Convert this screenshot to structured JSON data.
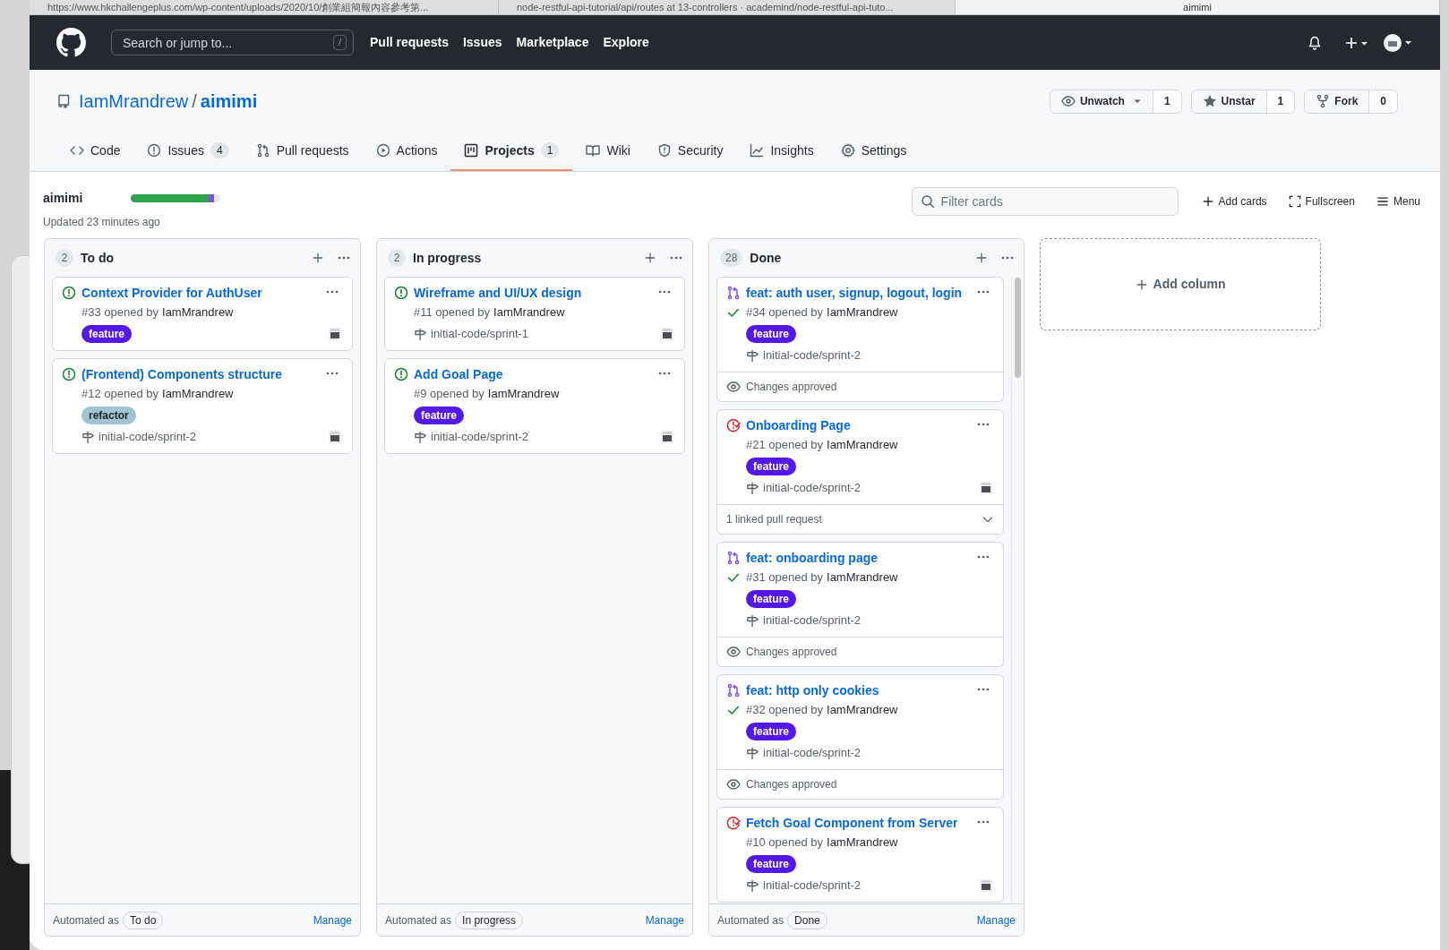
{
  "browser_tabs": [
    {
      "title": "https://www.hkchallengeplus.com/wp-content/uploads/2020/10/創業組簡報內容參考第...",
      "selected": false
    },
    {
      "title": "node-restful-api-tutorial/api/routes at 13-controllers · academind/node-restful-api-tuto...",
      "selected": false
    },
    {
      "title": "aimimi",
      "selected": true
    }
  ],
  "header": {
    "search_placeholder": "Search or jump to...",
    "search_key": "/",
    "nav": [
      "Pull requests",
      "Issues",
      "Marketplace",
      "Explore"
    ]
  },
  "repo": {
    "owner": "IamMrandrew",
    "separator": "/",
    "name": "aimimi",
    "actions": [
      {
        "kind": "watch",
        "label": "Unwatch",
        "count": "1"
      },
      {
        "kind": "star",
        "label": "Unstar",
        "count": "1"
      },
      {
        "kind": "fork",
        "label": "Fork",
        "count": "0"
      }
    ]
  },
  "tabs": [
    {
      "kind": "code",
      "label": "Code",
      "selected": false
    },
    {
      "kind": "issues",
      "label": "Issues",
      "count": "4",
      "selected": false
    },
    {
      "kind": "pulls",
      "label": "Pull requests",
      "selected": false
    },
    {
      "kind": "actions",
      "label": "Actions",
      "selected": false
    },
    {
      "kind": "projects",
      "label": "Projects",
      "count": "1",
      "selected": true
    },
    {
      "kind": "wiki",
      "label": "Wiki",
      "selected": false
    },
    {
      "kind": "security",
      "label": "Security",
      "selected": false
    },
    {
      "kind": "insights",
      "label": "Insights",
      "selected": false
    },
    {
      "kind": "settings",
      "label": "Settings",
      "selected": false
    }
  ],
  "project": {
    "name": "aimimi",
    "updated": "Updated 23 minutes ago",
    "progress": [
      {
        "kind": "done",
        "level": 0.87
      },
      {
        "kind": "in_progress",
        "level": 0.06
      }
    ],
    "filter_placeholder": "Filter cards",
    "actions": [
      {
        "kind": "add",
        "label": "Add cards"
      },
      {
        "kind": "fullscreen",
        "label": "Fullscreen"
      },
      {
        "kind": "menu",
        "label": "Menu"
      }
    ]
  },
  "columns": [
    {
      "count": "2",
      "title": "To do",
      "automated_label": "Automated as",
      "automated_state": "To do",
      "manage": "Manage",
      "cards": [
        {
          "kind": "issue_open",
          "title": "Context Provider for AuthUser",
          "meta": "#33 opened by",
          "author": "IamMrandrew",
          "checks_passed": false,
          "labels": [
            {
              "text": "feature",
              "color": "#5319e7"
            }
          ],
          "avatar": true
        },
        {
          "kind": "issue_open",
          "title": "(Frontend) Components structure",
          "meta": "#12 opened by",
          "author": "IamMrandrew",
          "checks_passed": false,
          "labels": [
            {
              "text": "refactor",
              "color": "#a2c4cf"
            }
          ],
          "branch": "initial-code/sprint-2",
          "avatar": true
        }
      ]
    },
    {
      "count": "2",
      "title": "In progress",
      "automated_label": "Automated as",
      "automated_state": "In progress",
      "manage": "Manage",
      "cards": [
        {
          "kind": "issue_open",
          "title": "Wireframe and UI/UX design",
          "meta": "#11 opened by",
          "author": "IamMrandrew",
          "checks_passed": false,
          "branch": "initial-code/sprint-1",
          "avatar": true
        },
        {
          "kind": "issue_open",
          "title": "Add Goal Page",
          "meta": "#9 opened by",
          "author": "IamMrandrew",
          "checks_passed": false,
          "labels": [
            {
              "text": "feature",
              "color": "#5319e7"
            }
          ],
          "branch": "initial-code/sprint-2",
          "avatar": true
        }
      ]
    },
    {
      "count": "28",
      "title": "Done",
      "automated_label": "Automated as",
      "automated_state": "Done",
      "manage": "Manage",
      "scrollable": true,
      "cards": [
        {
          "kind": "pull_request",
          "title": "feat: auth user, signup, logout, login",
          "meta": "#34 opened by",
          "author": "IamMrandrew",
          "checks_passed": true,
          "labels": [
            {
              "text": "feature",
              "color": "#5319e7"
            }
          ],
          "branch": "initial-code/sprint-2",
          "avatar": false,
          "footer": {
            "kind": "review",
            "text": "Changes approved"
          }
        },
        {
          "kind": "issue_closed",
          "title": "Onboarding Page",
          "meta": "#21 opened by",
          "author": "IamMrandrew",
          "checks_passed": false,
          "labels": [
            {
              "text": "feature",
              "color": "#5319e7"
            }
          ],
          "branch": "initial-code/sprint-2",
          "avatar": true,
          "footer": {
            "kind": "linked",
            "text": "1 linked pull request"
          }
        },
        {
          "kind": "pull_request",
          "title": "feat: onboarding page",
          "meta": "#31 opened by",
          "author": "IamMrandrew",
          "checks_passed": true,
          "labels": [
            {
              "text": "feature",
              "color": "#5319e7"
            }
          ],
          "branch": "initial-code/sprint-2",
          "avatar": false,
          "footer": {
            "kind": "review",
            "text": "Changes approved"
          }
        },
        {
          "kind": "pull_request",
          "title": "feat: http only cookies",
          "meta": "#32 opened by",
          "author": "IamMrandrew",
          "checks_passed": true,
          "labels": [
            {
              "text": "feature",
              "color": "#5319e7"
            }
          ],
          "branch": "initial-code/sprint-2",
          "avatar": false,
          "footer": {
            "kind": "review",
            "text": "Changes approved"
          }
        },
        {
          "kind": "issue_closed",
          "title": "Fetch Goal Component from Server",
          "meta": "#10 opened by",
          "author": "IamMrandrew",
          "checks_passed": false,
          "labels": [
            {
              "text": "feature",
              "color": "#5319e7"
            }
          ],
          "branch": "initial-code/sprint-2",
          "avatar": true
        }
      ]
    }
  ],
  "add_column": "Add column"
}
